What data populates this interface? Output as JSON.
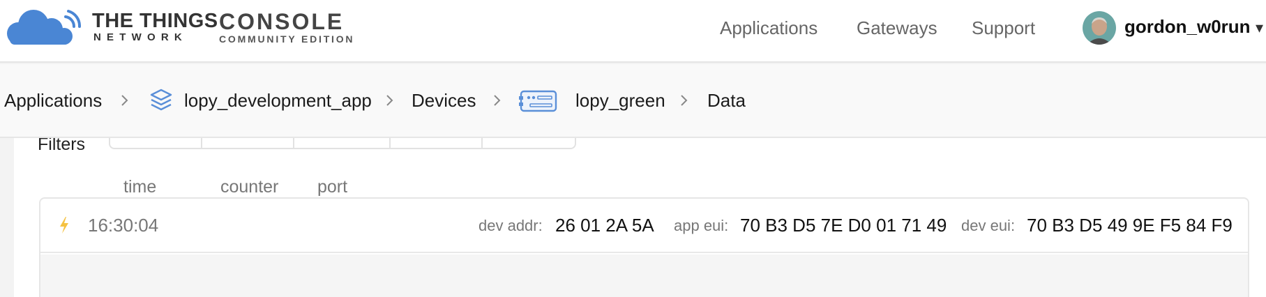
{
  "header": {
    "brand_main": "THE THINGS",
    "brand_sub": "NETWORK",
    "console_main": "CONSOLE",
    "console_sub": "COMMUNITY EDITION",
    "nav": [
      "Applications",
      "Gateways",
      "Support"
    ],
    "username": "gordon_w0run",
    "caret": "▾"
  },
  "breadcrumb": {
    "items": [
      "Applications",
      "lopy_development_app",
      "Devices",
      "lopy_green",
      "Data"
    ]
  },
  "data_view": {
    "filters_label": "Filters",
    "columns": [
      "time",
      "counter",
      "port"
    ],
    "messages": [
      {
        "time": "16:30:04",
        "dev_addr_label": "dev addr:",
        "dev_addr": "26 01 2A 5A",
        "app_eui_label": "app eui:",
        "app_eui": "70 B3 D5 7E D0 01 71 49",
        "dev_eui_label": "dev eui:",
        "dev_eui": "70 B3 D5 49 9E F5 84 F9"
      }
    ]
  },
  "icons": {
    "logo": "cloud-logo-icon",
    "application": "layers-icon",
    "device": "device-icon",
    "uplink": "lightning-bolt-icon",
    "separator": "chevron-right-icon"
  },
  "colors": {
    "brand_blue": "#4a86d4",
    "uplink_bolt": "#f5c242",
    "icon_blue": "#5a8fd8"
  }
}
